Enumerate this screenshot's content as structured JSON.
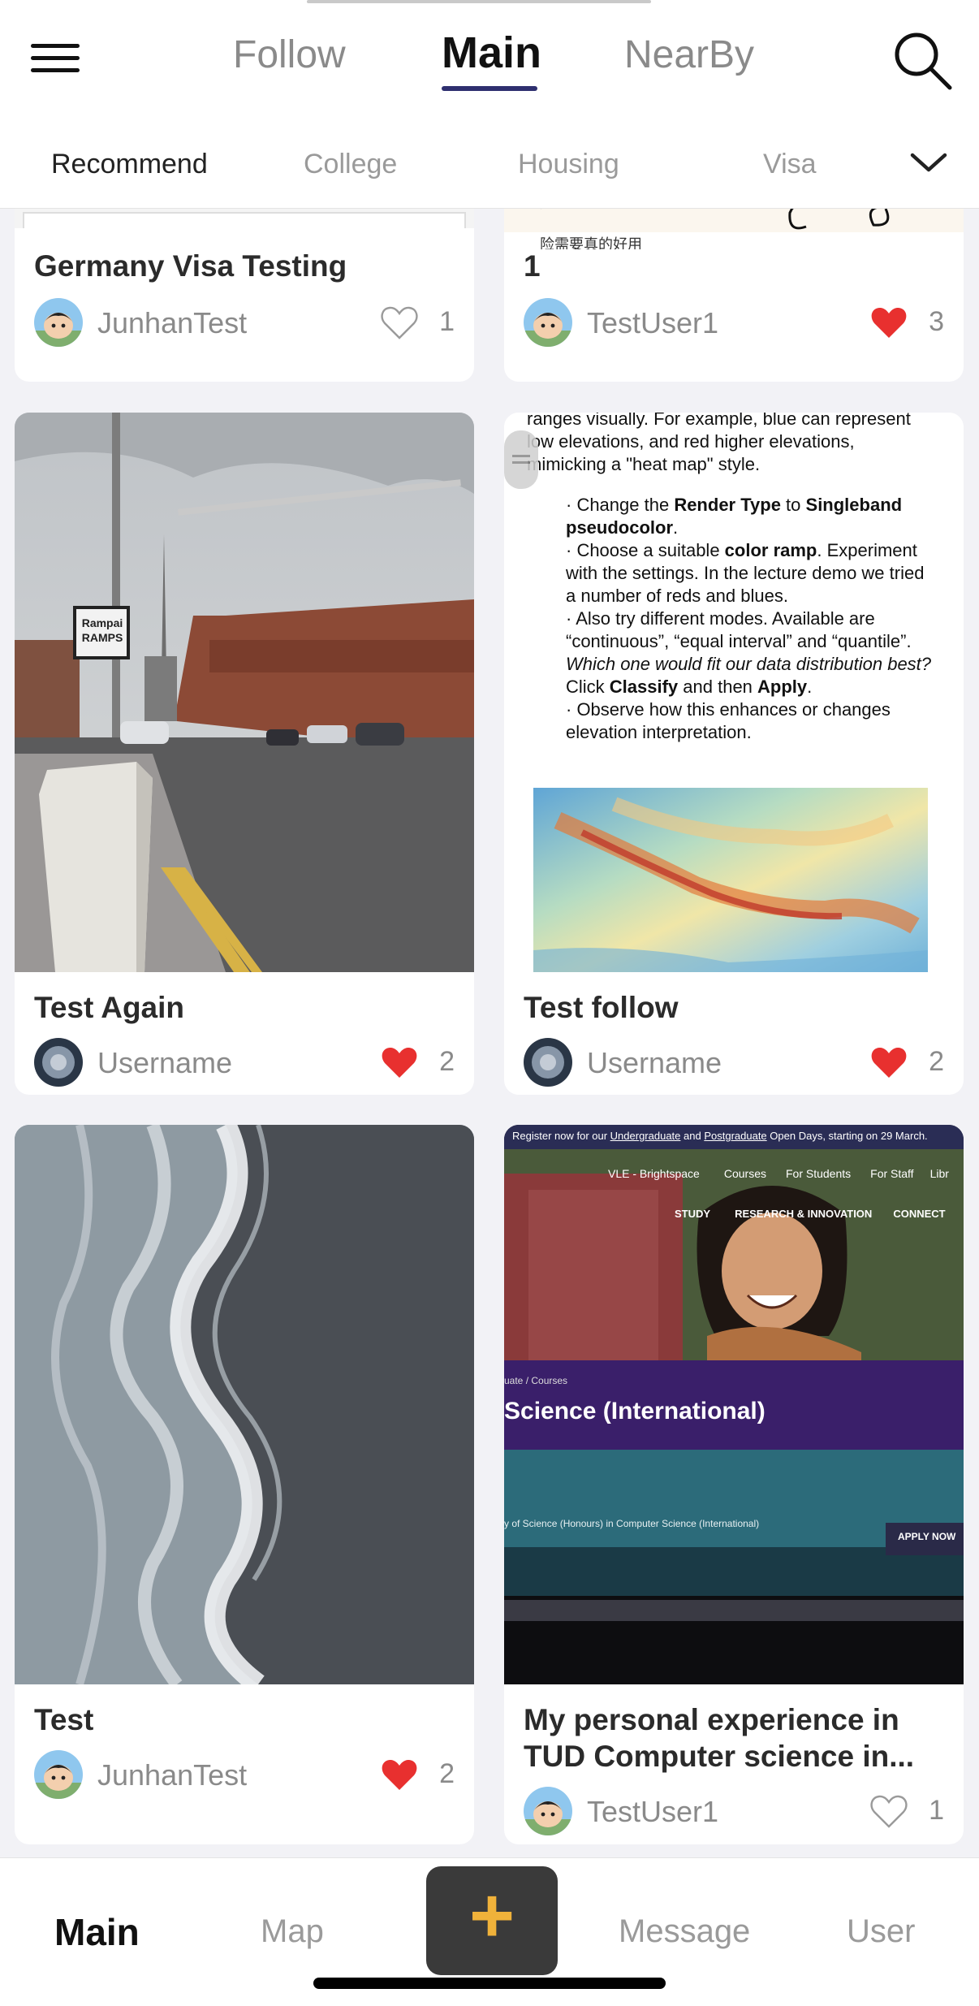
{
  "header": {
    "tabs": [
      {
        "label": "Follow"
      },
      {
        "label": "Main"
      },
      {
        "label": "NearBy"
      }
    ],
    "active_tab": "Main"
  },
  "categories": [
    {
      "label": "Recommend"
    },
    {
      "label": "College"
    },
    {
      "label": "Housing"
    },
    {
      "label": "Visa"
    }
  ],
  "posts": [
    {
      "title": "Germany Visa Testing",
      "author": "JunhanTest",
      "likes": "1",
      "liked": false
    },
    {
      "title": "1",
      "author": "TestUser1",
      "likes": "3",
      "liked": true
    },
    {
      "title": "Test Again",
      "author": "Username",
      "likes": "2",
      "liked": true
    },
    {
      "title": "Test follow",
      "author": "Username",
      "likes": "2",
      "liked": true
    },
    {
      "title": "Test",
      "author": "JunhanTest",
      "likes": "2",
      "liked": true
    },
    {
      "title": "My personal experience in TUD Computer science in...",
      "author": "TestUser1",
      "likes": "1",
      "liked": false
    }
  ],
  "post_images": {
    "doc_text": {
      "line1": "ranges visually. For example, blue can represent",
      "line2": "low elevations, and red higher elevations,",
      "line3": "mimicking a \"heat map\" style.",
      "b1a": "· Change the ",
      "b1b": "Render Type",
      "b1c": " to ",
      "b1d": "Singleband",
      "b1e": "pseudocolor",
      "b2a": "· Choose a suitable ",
      "b2b": "color ramp",
      "b2c": ". Experiment",
      "b2d": "with the settings. In the lecture demo we tried",
      "b2e": "a number of reds and blues.",
      "b3a": "· Also try different modes. Available are",
      "b3b": "“continuous”, “equal interval” and “quantile”.",
      "b3c": "Which one would fit our data distribution best?",
      "b3d": "Click ",
      "b3e": "Classify",
      "b3f": " and then ",
      "b3g": "Apply",
      "b4a": "· Observe how this enhances or changes",
      "b4b": "elevation interpretation."
    },
    "street_sign": {
      "line1": "Rampai",
      "line2": "RAMPS"
    },
    "web_screen": {
      "banner_a": "Register now for our ",
      "banner_b": "Undergraduate",
      "banner_c": " and ",
      "banner_d": "Postgraduate",
      "banner_e": " Open Days, starting on 29 March.",
      "nav": [
        "VLE - Brightspace",
        "Courses",
        "For Students",
        "For Staff",
        "Libr"
      ],
      "menu": [
        "STUDY",
        "RESEARCH & INNOVATION",
        "CONNECT"
      ],
      "breadcrumb": "uate  /  Courses",
      "heading": "Science (International)",
      "subtitle": "y of Science (Honours) in Computer Science (International)",
      "apply": "APPLY NOW"
    },
    "partial_caption": "险需要真的好用"
  },
  "bottom_nav": {
    "items": [
      {
        "label": "Main"
      },
      {
        "label": "Map"
      },
      {
        "label": "Message"
      },
      {
        "label": "User"
      }
    ],
    "plus": "+"
  },
  "colors": {
    "accent_underline": "#2e2f6f",
    "liked_heart": "#e8302f",
    "plus_icon": "#f0b23a"
  }
}
